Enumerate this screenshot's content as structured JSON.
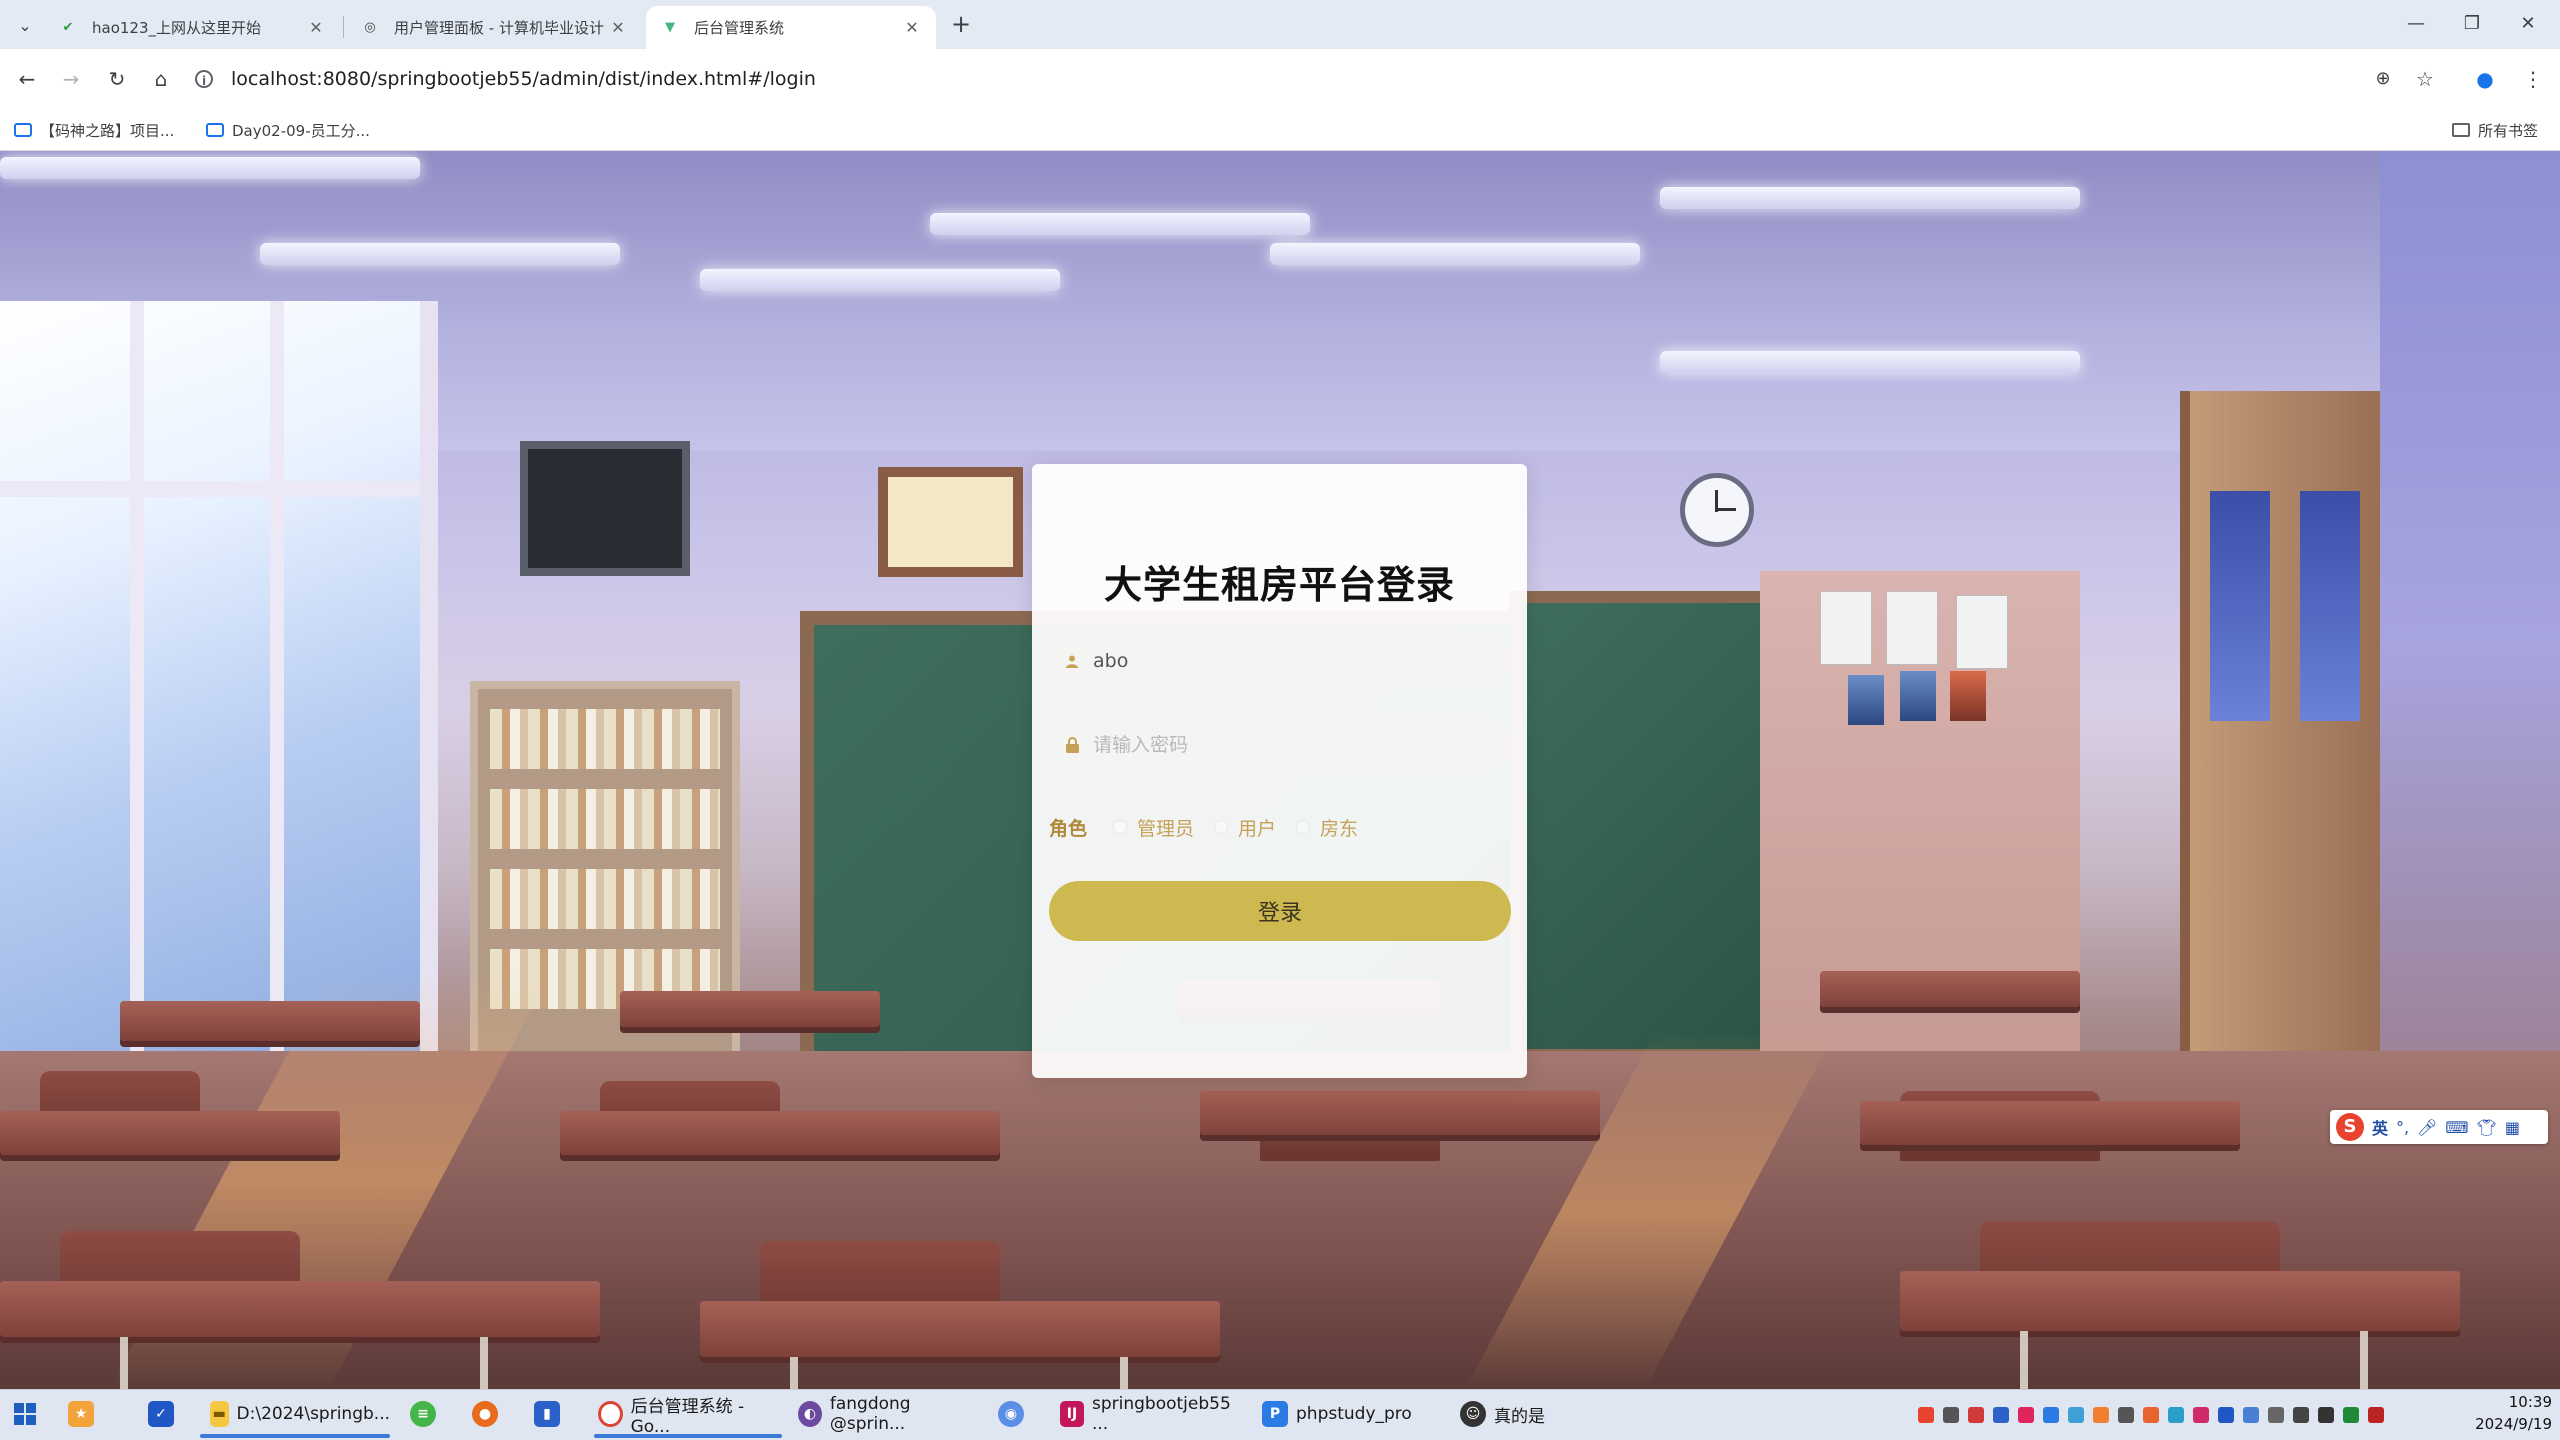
{
  "browser": {
    "tabs": [
      {
        "title": "hao123_上网从这里开始",
        "active": false
      },
      {
        "title": "用户管理面板 - 计算机毕业设计",
        "active": false
      },
      {
        "title": "后台管理系统",
        "active": true
      }
    ],
    "url": "localhost:8080/springbootjeb55/admin/dist/index.html#/login",
    "bookmarks": [
      "【码神之路】项目...",
      "Day02-09-员工分..."
    ],
    "all_bookmarks_label": "所有书签"
  },
  "login": {
    "title": "大学生租房平台登录",
    "username_value": "abo",
    "password_placeholder": "请输入密码",
    "role_label": "角色",
    "roles": [
      "管理员",
      "用户",
      "房东"
    ],
    "submit_label": "登录"
  },
  "ime": {
    "mode": "英",
    "punct": "°,"
  },
  "taskbar": {
    "items": [
      {
        "label": "D:\\2024\\springb...",
        "icon": "folder-icon"
      },
      {
        "label": "后台管理系统 - Go...",
        "icon": "chrome-icon"
      },
      {
        "label": "fangdong @sprin...",
        "icon": "eclipse-icon"
      },
      {
        "label": "springbootjeb55 ...",
        "icon": "intellij-icon"
      },
      {
        "label": "phpstudy_pro",
        "icon": "phpstudy-icon"
      },
      {
        "label": "真的是",
        "icon": "app-icon"
      }
    ],
    "time": "10:39",
    "date": "2024/9/19"
  },
  "colors": {
    "accent_button": "#cdb94f",
    "role_text": "#c5a257",
    "role_label": "#b08a3a"
  }
}
